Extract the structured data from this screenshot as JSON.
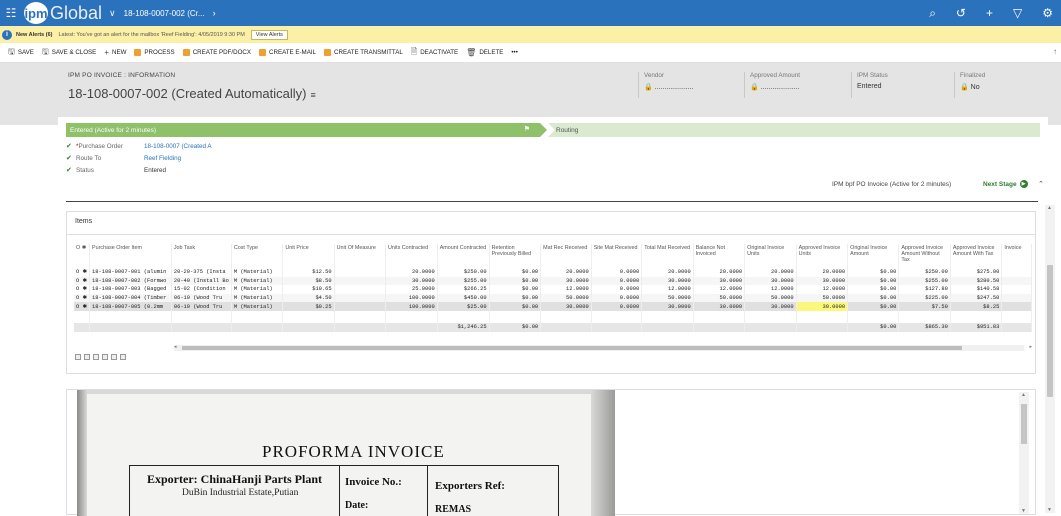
{
  "topbar": {
    "app_logo_mark": "ipm",
    "app_logo_text": "Global",
    "breadcrumb": "18-108-0007-002 (Cr...",
    "icons": [
      "search-icon",
      "history-icon",
      "plus-icon",
      "filter-icon",
      "gear-icon"
    ]
  },
  "alert": {
    "count_label": "New Alerts (6)",
    "message": "Latest: You've got an alert for the mailbox 'Reef Fielding': 4/05/2019 9:30 PM",
    "view_button": "View Alerts"
  },
  "commands": [
    {
      "label": "SAVE",
      "icon": "save-icon"
    },
    {
      "label": "SAVE & CLOSE",
      "icon": "save-close-icon"
    },
    {
      "label": "NEW",
      "icon": "plus-icon"
    },
    {
      "label": "PROCESS",
      "icon": "process-icon"
    },
    {
      "label": "CREATE PDF/DOCX",
      "icon": "pdf-icon"
    },
    {
      "label": "CREATE E-MAIL",
      "icon": "email-icon"
    },
    {
      "label": "CREATE TRANSMITTAL",
      "icon": "transmittal-icon"
    },
    {
      "label": "DEACTIVATE",
      "icon": "deactivate-icon"
    },
    {
      "label": "DELETE",
      "icon": "delete-icon"
    },
    {
      "label": "•••",
      "icon": "more-icon"
    }
  ],
  "header": {
    "entity": "IPM PO INVOICE : INFORMATION",
    "title": "18-108-0007-002 (Created Automatically)",
    "fields": [
      {
        "label": "Vendor",
        "value": "🔒 ...................."
      },
      {
        "label": "Approved Amount",
        "value": "🔒 ...................."
      },
      {
        "label": "IPM Status",
        "value": "Entered"
      },
      {
        "label": "Finalized",
        "value": "🔒 No"
      }
    ]
  },
  "bpf": {
    "stage_active": "Entered (Active for 2 minutes)",
    "stage_next": "Routing",
    "fields": [
      {
        "label": "Purchase Order",
        "value": "18-108-0007 (Created A",
        "required": "*",
        "link": true
      },
      {
        "label": "Route To",
        "value": "Reef Fielding",
        "required": "",
        "link": true
      },
      {
        "label": "Status",
        "value": "Entered",
        "required": "",
        "link": false
      }
    ],
    "process_name": "IPM bpf PO Invoice (Active for 2 minutes)",
    "next_stage": "Next Stage"
  },
  "items": {
    "title": "Items",
    "columns": [
      "O ✱",
      "Purchase Order Item",
      "Job Task",
      "Cost Type",
      "Unit Price",
      "Unit Of Measure",
      "Units Contracted",
      "Amount Contracted",
      "Retention Previously Billed",
      "Mat Rec Received",
      "Site Mat Received",
      "Total Mat Received",
      "Balance Not Invoiced",
      "Original Invoice Units",
      "Approved Invoice Units",
      "Original Invoice Amount",
      "Approved Invoice Amount Without Tax",
      "Approved Invoice Amount With Tax",
      "Invoice"
    ],
    "rows": [
      [
        "O ✱",
        "18-108-0007-001 (alumin",
        "20-20-375 (Insta",
        "M (Material)",
        "$12.50",
        "",
        "20.0000",
        "$250.00",
        "$0.00",
        "20.0000",
        "0.0000",
        "20.0000",
        "20.0000",
        "20.0000",
        "20.0000",
        "$0.00",
        "$250.00",
        "$275.00",
        ""
      ],
      [
        "O ✱",
        "18-108-0007-002 (Formwo",
        "20-40 (Install Bo",
        "M (Material)",
        "$8.50",
        "",
        "30.0000",
        "$255.00",
        "$0.00",
        "30.0000",
        "0.0000",
        "30.0000",
        "30.0000",
        "30.0000",
        "30.0000",
        "$0.00",
        "$255.00",
        "$280.50",
        ""
      ],
      [
        "O ✱",
        "18-108-0007-003 (Bagged",
        "15-02 (Condition",
        "M (Material)",
        "$10.65",
        "",
        "25.0000",
        "$266.25",
        "$0.00",
        "12.0000",
        "0.0000",
        "12.0000",
        "12.0000",
        "12.0000",
        "12.0000",
        "$0.00",
        "$127.80",
        "$140.58",
        ""
      ],
      [
        "O ✱",
        "18-108-0007-004 (Timber",
        "06-19 (Wood Tru",
        "M (Material)",
        "$4.50",
        "",
        "100.0000",
        "$450.00",
        "$0.00",
        "50.0000",
        "0.0000",
        "50.0000",
        "50.0000",
        "50.0000",
        "50.0000",
        "$0.00",
        "$225.00",
        "$247.50",
        ""
      ],
      [
        "O ✱",
        "18-108-0007-005 (0.2mm",
        "06-19 (Wood Tru",
        "M (Material)",
        "$0.25",
        "",
        "100.0000",
        "$25.00",
        "$0.00",
        "30.0000",
        "0.0000",
        "30.0000",
        "30.0000",
        "30.0000",
        "30.0000",
        "$0.00",
        "$7.50",
        "$8.25",
        ""
      ]
    ],
    "totals": [
      "",
      "",
      "",
      "",
      "",
      "",
      "",
      "$1,246.25",
      "$0.00",
      "",
      "",
      "",
      "",
      "",
      "",
      "$0.00",
      "$865.30",
      "$951.83",
      ""
    ]
  },
  "document": {
    "title": "PROFORMA INVOICE",
    "exporter": "Exporter: ChinaHanji Parts Plant",
    "address": "DuBin Industrial Estate,Putian",
    "invoice_no": "Invoice No.:",
    "date": "Date:",
    "exporters_ref": "Exporters Ref:",
    "ref_partial": "REMAS"
  },
  "colors": {
    "topbar": "#2b72bd",
    "alert": "#fbf0a6",
    "stage_active": "#8fc06a",
    "stage_next": "#d9ead0",
    "highlight": "#fbf77a"
  }
}
